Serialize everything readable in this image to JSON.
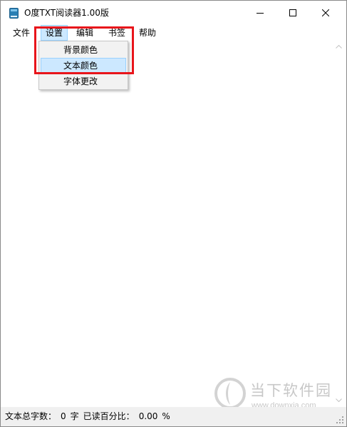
{
  "window": {
    "title": "O度TXT阅读器1.00版",
    "minimize_icon": "minimize-icon",
    "maximize_icon": "maximize-icon",
    "close_icon": "close-icon"
  },
  "menubar": {
    "items": [
      {
        "label": "文件"
      },
      {
        "label": "设置",
        "active": true
      },
      {
        "label": "编辑"
      },
      {
        "label": "书签"
      },
      {
        "label": "帮助"
      }
    ]
  },
  "settings_menu": {
    "items": [
      {
        "label": "背景颜色"
      },
      {
        "label": "文本颜色",
        "highlighted": true
      },
      {
        "label": "字体更改"
      }
    ]
  },
  "statusbar": {
    "total_label": "文本总字数：",
    "total_value": "0",
    "total_unit": "字",
    "read_label": "已读百分比：",
    "read_value": "0.00",
    "read_unit": "%"
  },
  "watermark": {
    "brand": "当下软件园",
    "url": "www.downxia.com"
  },
  "colors": {
    "highlight_bg": "#cce8ff",
    "highlight_border": "#99d1ff",
    "annotation_red": "#e8151b",
    "statusbar_bg": "#f0f0f0"
  }
}
